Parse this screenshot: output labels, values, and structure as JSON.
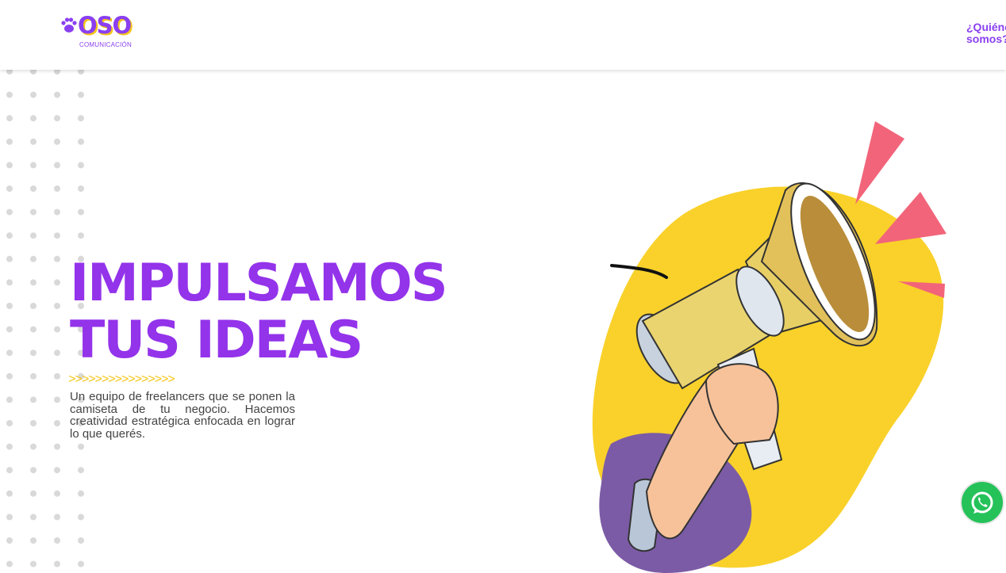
{
  "header": {
    "logo_text": "OSO",
    "logo_subtitle": "COMUNICACIÓN",
    "nav_link": "¿Quiénes\nsomos?"
  },
  "hero": {
    "headline_line1": "IMPULSAMOS",
    "headline_line2": "TUS IDEAS",
    "arrows": ">>>>>>>>>>>>>>>>",
    "description": "Un equipo de freelancers que se ponen la camiseta de tu negocio. Hacemos creatividad estratégica enfocada en lograr lo que querés."
  },
  "floating": {
    "whatsapp_icon": "whatsapp-icon"
  },
  "colors": {
    "brand_purple": "#8a3ff0",
    "brand_yellow": "#f5c518",
    "whatsapp_green": "#25c25a"
  }
}
